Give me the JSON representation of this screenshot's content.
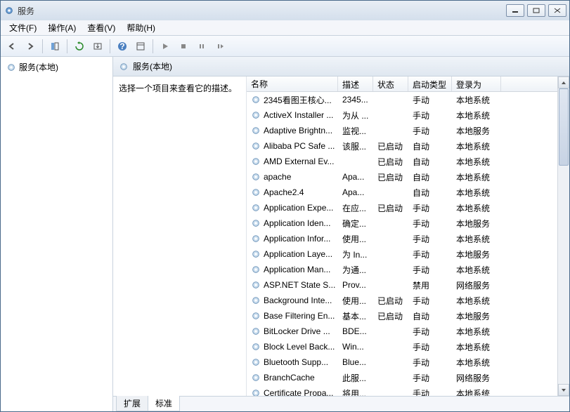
{
  "window": {
    "title": "服务"
  },
  "menu": {
    "file": "文件(F)",
    "action": "操作(A)",
    "view": "查看(V)",
    "help": "帮助(H)"
  },
  "nav": {
    "root": "服务(本地)"
  },
  "main": {
    "header": "服务(本地)",
    "desc_prompt": "选择一个项目来查看它的描述。"
  },
  "columns": {
    "name": "名称",
    "desc": "描述",
    "status": "状态",
    "startup": "启动类型",
    "logon": "登录为"
  },
  "tabs": {
    "extended": "扩展",
    "standard": "标准"
  },
  "services": [
    {
      "name": "2345看图王核心...",
      "desc": "2345...",
      "status": "",
      "startup": "手动",
      "logon": "本地系统"
    },
    {
      "name": "ActiveX Installer ...",
      "desc": "为从 ...",
      "status": "",
      "startup": "手动",
      "logon": "本地系统"
    },
    {
      "name": "Adaptive Brightn...",
      "desc": "监视...",
      "status": "",
      "startup": "手动",
      "logon": "本地服务"
    },
    {
      "name": "Alibaba PC Safe ...",
      "desc": "该服...",
      "status": "已启动",
      "startup": "自动",
      "logon": "本地系统"
    },
    {
      "name": "AMD External Ev...",
      "desc": "",
      "status": "已启动",
      "startup": "自动",
      "logon": "本地系统"
    },
    {
      "name": "apache",
      "desc": "Apa...",
      "status": "已启动",
      "startup": "自动",
      "logon": "本地系统"
    },
    {
      "name": "Apache2.4",
      "desc": "Apa...",
      "status": "",
      "startup": "自动",
      "logon": "本地系统"
    },
    {
      "name": "Application Expe...",
      "desc": "在应...",
      "status": "已启动",
      "startup": "手动",
      "logon": "本地系统"
    },
    {
      "name": "Application Iden...",
      "desc": "确定...",
      "status": "",
      "startup": "手动",
      "logon": "本地服务"
    },
    {
      "name": "Application Infor...",
      "desc": "使用...",
      "status": "",
      "startup": "手动",
      "logon": "本地系统"
    },
    {
      "name": "Application Laye...",
      "desc": "为 In...",
      "status": "",
      "startup": "手动",
      "logon": "本地服务"
    },
    {
      "name": "Application Man...",
      "desc": "为通...",
      "status": "",
      "startup": "手动",
      "logon": "本地系统"
    },
    {
      "name": "ASP.NET State S...",
      "desc": "Prov...",
      "status": "",
      "startup": "禁用",
      "logon": "网络服务"
    },
    {
      "name": "Background Inte...",
      "desc": "使用...",
      "status": "已启动",
      "startup": "手动",
      "logon": "本地系统"
    },
    {
      "name": "Base Filtering En...",
      "desc": "基本...",
      "status": "已启动",
      "startup": "自动",
      "logon": "本地服务"
    },
    {
      "name": "BitLocker Drive ...",
      "desc": "BDE...",
      "status": "",
      "startup": "手动",
      "logon": "本地系统"
    },
    {
      "name": "Block Level Back...",
      "desc": "Win...",
      "status": "",
      "startup": "手动",
      "logon": "本地系统"
    },
    {
      "name": "Bluetooth Supp...",
      "desc": "Blue...",
      "status": "",
      "startup": "手动",
      "logon": "本地系统"
    },
    {
      "name": "BranchCache",
      "desc": "此服...",
      "status": "",
      "startup": "手动",
      "logon": "网络服务"
    },
    {
      "name": "Certificate Propa...",
      "desc": "将用...",
      "status": "",
      "startup": "手动",
      "logon": "本地系统"
    }
  ]
}
